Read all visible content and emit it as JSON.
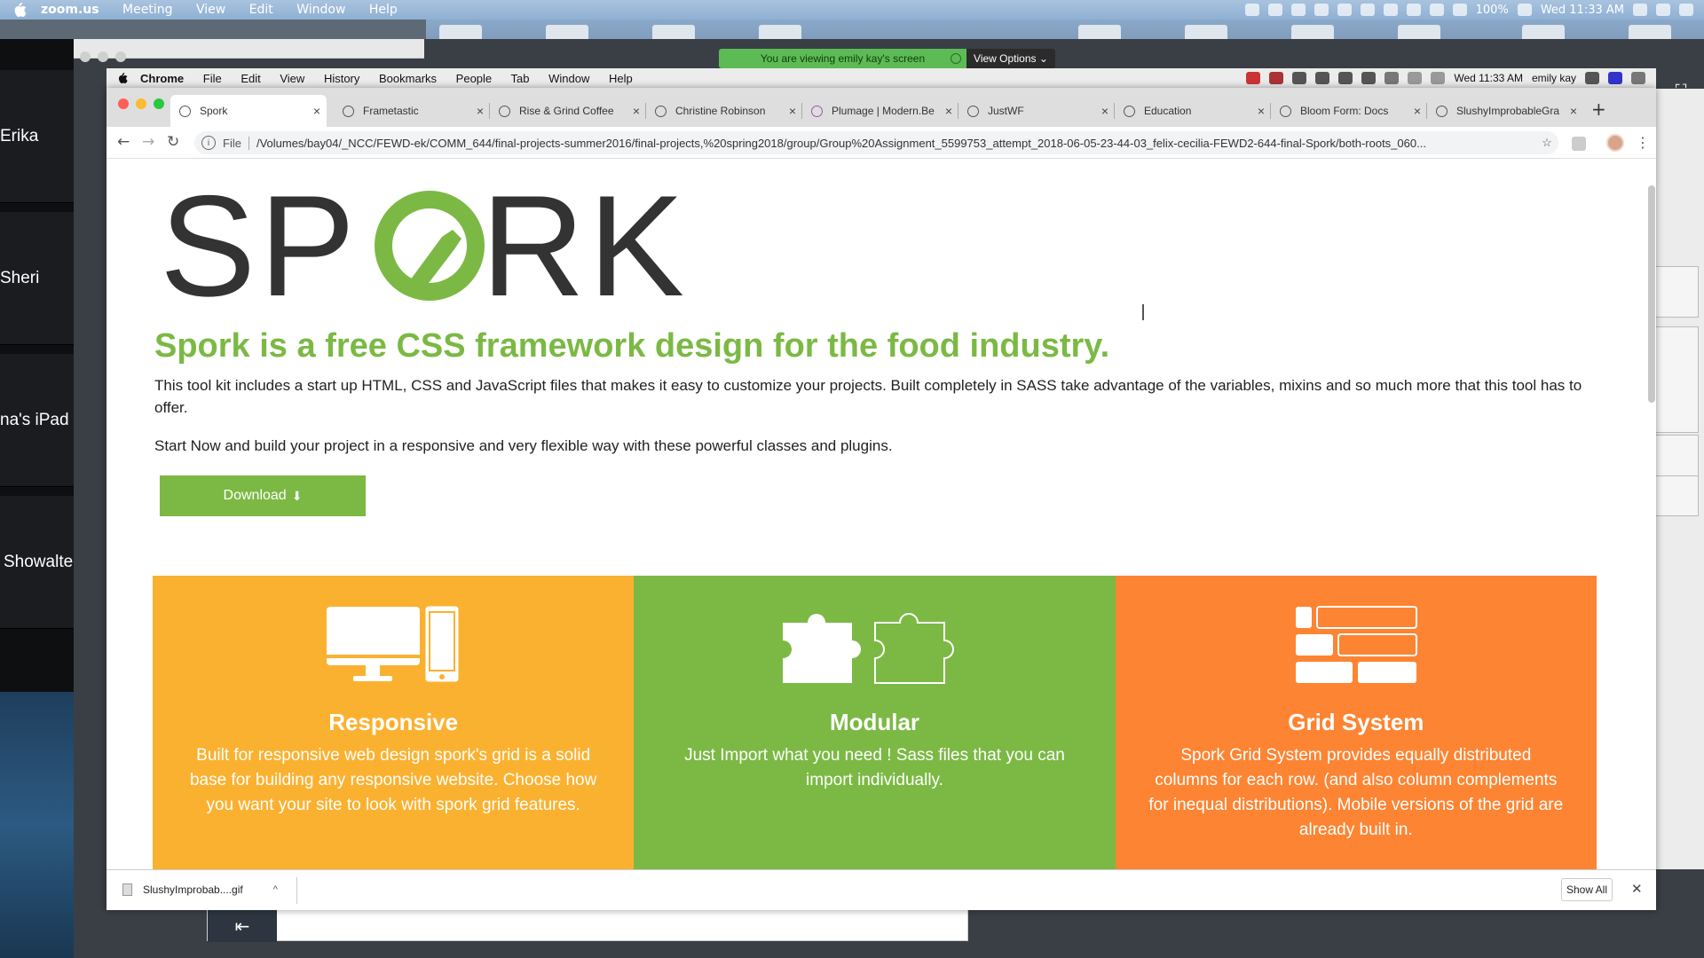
{
  "mac_menubar": {
    "app": "zoom.us",
    "menus": [
      "Meeting",
      "View",
      "Edit",
      "Window",
      "Help"
    ],
    "battery": "100%",
    "clock": "Wed 11:33 AM"
  },
  "zoom": {
    "share_banner": "You are viewing emily kay's screen",
    "view_options": "View Options",
    "participants": [
      "Erika",
      "Sheri",
      "na's iPad",
      "Showalte"
    ]
  },
  "chrome_menubar": {
    "app": "Chrome",
    "menus": [
      "File",
      "Edit",
      "View",
      "History",
      "Bookmarks",
      "People",
      "Tab",
      "Window",
      "Help"
    ],
    "clock": "Wed 11:33 AM",
    "user": "emily kay"
  },
  "tabs": [
    {
      "title": "Spork",
      "active": true
    },
    {
      "title": "Frametastic"
    },
    {
      "title": "Rise & Grind Coffee"
    },
    {
      "title": "Christine Robinson"
    },
    {
      "title": "Plumage | Modern.Be"
    },
    {
      "title": "JustWF"
    },
    {
      "title": "Education"
    },
    {
      "title": "Bloom Form: Docs"
    },
    {
      "title": "SlushyImprobableGra"
    }
  ],
  "address_bar": {
    "scheme": "File",
    "url": "/Volumes/bay04/_NCC/FEWD-ek/COMM_644/final-projects-summer2016/final-projects,%20spring2018/group/Group%20Assignment_5599753_attempt_2018-06-05-23-44-03_felix-cecilia-FEWD2-644-final-Spork/both-roots_060..."
  },
  "page": {
    "logo_text": "SPORK",
    "colors": {
      "green": "#7bb944",
      "yellow": "#fbb130",
      "orange": "#fd8432",
      "dark": "#333333"
    },
    "headline": "Spork is a free CSS framework design for the food industry.",
    "intro": "This tool kit includes a start up HTML, CSS and JavaScript files that makes it easy to customize your projects. Built completely in SASS take advantage of the variables, mixins and so much more that this tool has to offer.",
    "intro2": "Start Now and build your project in a responsive and very flexible way with these powerful classes and plugins.",
    "download_button": "Download",
    "features": [
      {
        "title": "Responsive",
        "icon": "devices-icon",
        "text": "Built for responsive web design spork's grid is a solid base for building any responsive website. Choose how you want your site to look with spork grid features."
      },
      {
        "title": "Modular",
        "icon": "puzzle-icon",
        "text": "Just Import what you need ! Sass files that you can import individually."
      },
      {
        "title": "Grid System",
        "icon": "grid-icon",
        "text": "Spork Grid System provides equally distributed columns for each row. (and also column complements for inequal distributions). Mobile versions of the grid are already built in."
      }
    ]
  },
  "download_shelf": {
    "file": "SlushyImprobab....gif",
    "show_all": "Show All"
  }
}
